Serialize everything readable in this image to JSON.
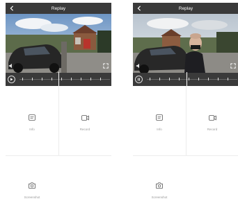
{
  "panels": [
    {
      "header": {
        "title": "Replay"
      },
      "actions": {
        "info_label": "Info",
        "record_label": "Record",
        "screenshot_label": "Screenshot"
      }
    },
    {
      "header": {
        "title": "Replay"
      },
      "actions": {
        "info_label": "Info",
        "record_label": "Record",
        "screenshot_label": "Screenshot"
      }
    }
  ],
  "timeline": {
    "tick_count": 9
  },
  "colors": {
    "header_bg": "#3a3a3a",
    "divider": "#ececec",
    "label": "#999999"
  }
}
